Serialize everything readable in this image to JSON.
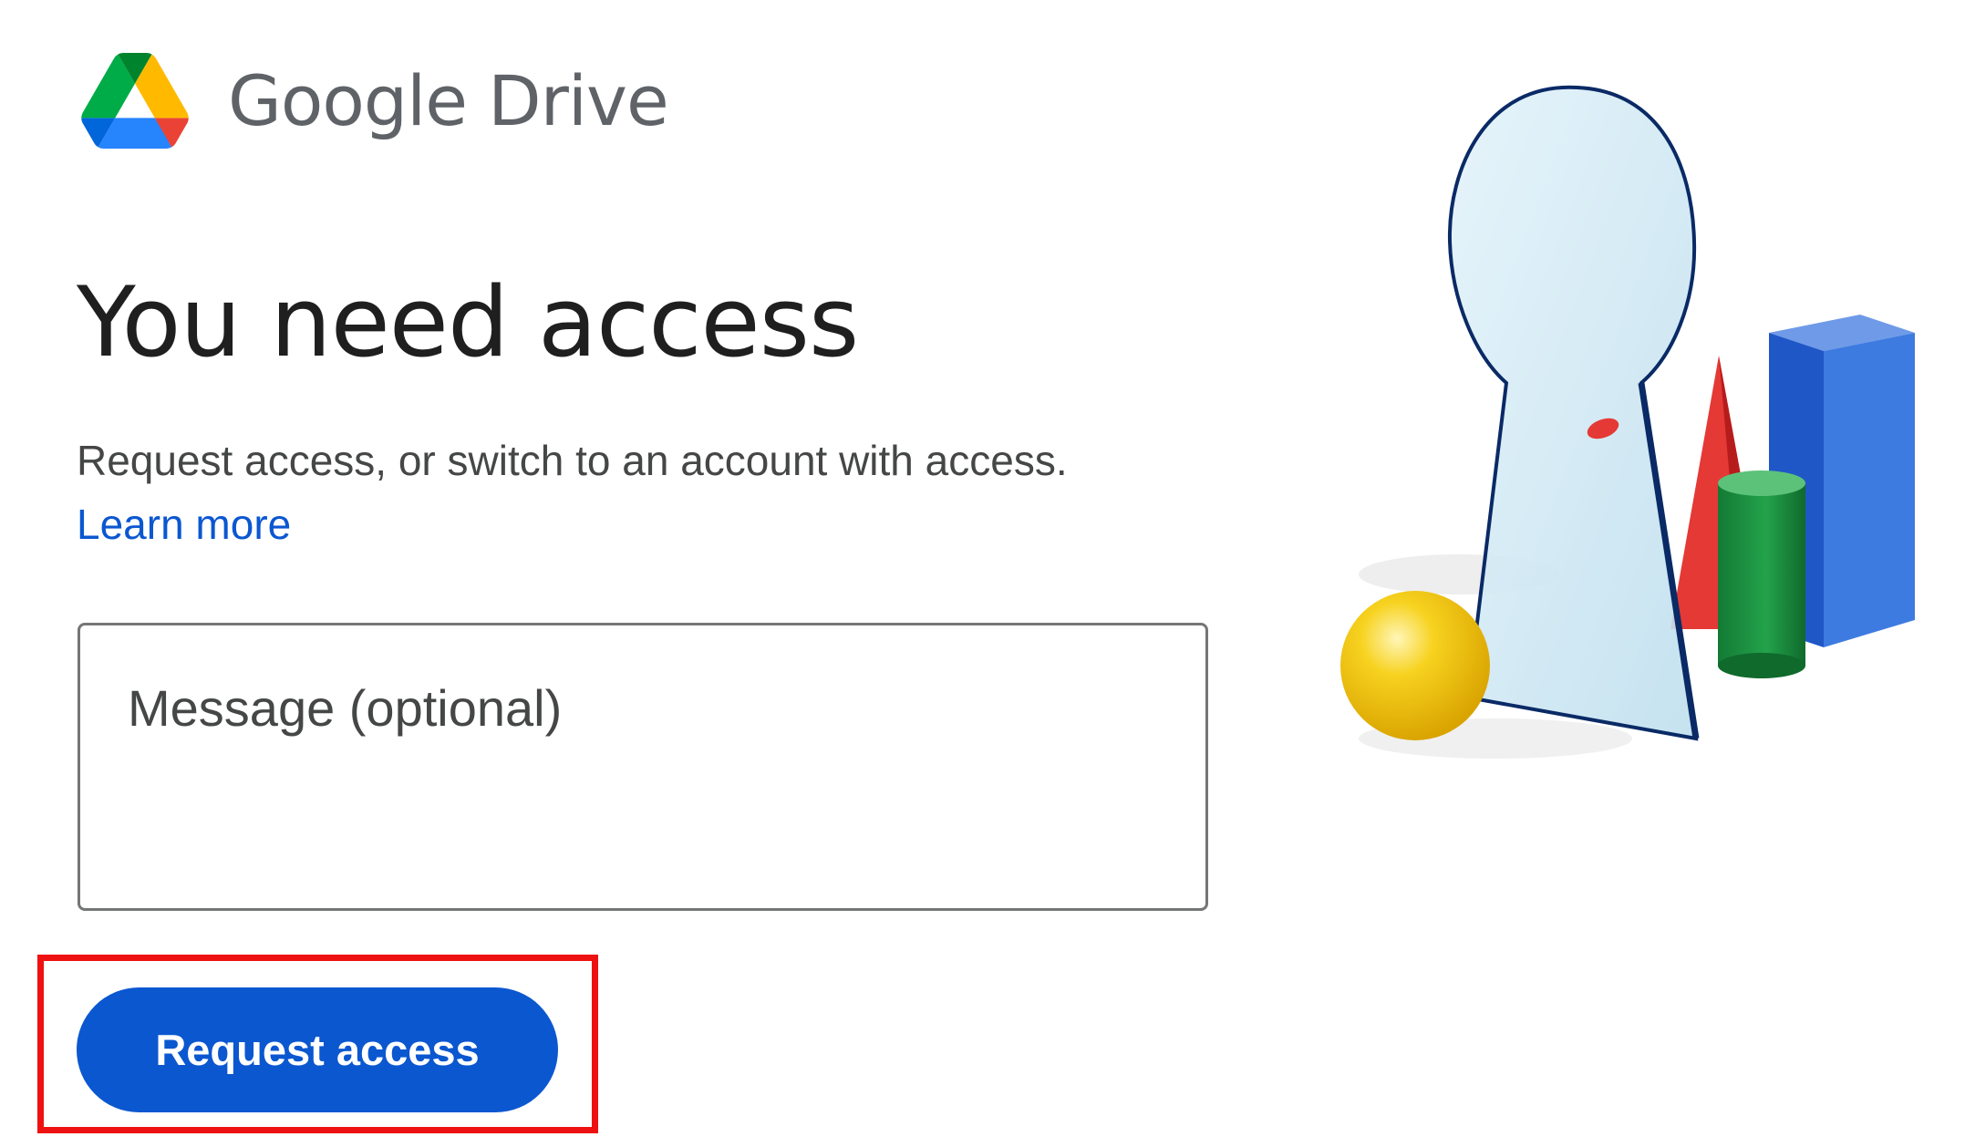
{
  "header": {
    "product_name": "Google Drive",
    "logo_icon": "google-drive-logo-icon"
  },
  "main": {
    "title": "You need access",
    "description": "Request access, or switch to an account with access.",
    "learn_more_label": "Learn more"
  },
  "form": {
    "message_placeholder": "Message (optional)",
    "message_value": "",
    "request_button_label": "Request access"
  },
  "annotation": {
    "highlight_color": "#ee1111"
  },
  "illustration": {
    "name": "keyhole-illustration",
    "colors": {
      "keyhole": "#d6ecf7",
      "keyhole_outline": "#0a2a66",
      "yellow_sphere": "#f4c20d",
      "red_cone": "#e53935",
      "green_cylinder": "#1e8e3e",
      "blue_box": "#2f6fd6"
    }
  },
  "colors": {
    "accent": "#0b57d0",
    "title_text": "#1f1f1f",
    "muted_text": "#444746",
    "border": "#747775"
  }
}
